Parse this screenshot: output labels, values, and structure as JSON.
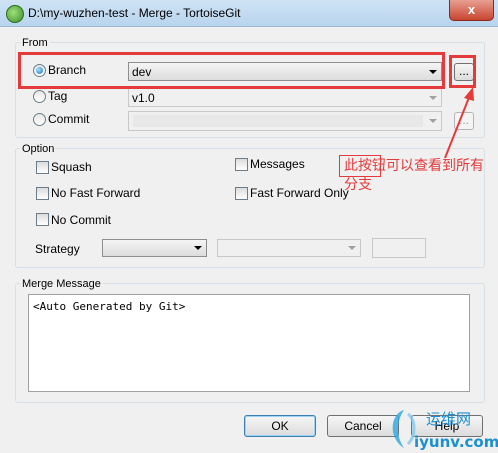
{
  "window": {
    "title": "D:\\my-wuzhen-test - Merge - TortoiseGit",
    "close": "x"
  },
  "from": {
    "label": "From",
    "branch": {
      "label": "Branch",
      "value": "dev",
      "selected": true,
      "browse": "..."
    },
    "tag": {
      "label": "Tag",
      "value": "v1.0"
    },
    "commit": {
      "label": "Commit",
      "value": "",
      "browse": "..."
    }
  },
  "option": {
    "label": "Option",
    "squash": "Squash",
    "messages": "Messages",
    "no_fast_forward": "No Fast Forward",
    "fast_forward_only": "Fast Forward Only",
    "no_commit": "No Commit",
    "strategy_label": "Strategy"
  },
  "merge_message": {
    "label": "Merge Message",
    "text": "<Auto Generated by Git>"
  },
  "buttons": {
    "ok": "OK",
    "cancel": "Cancel",
    "help": "Help"
  },
  "annotation": {
    "text": "此按钮可以查看到所有分支",
    "color": "#e53a3a"
  },
  "watermark": {
    "cn": "运维网",
    "site": "iyunv.com"
  }
}
